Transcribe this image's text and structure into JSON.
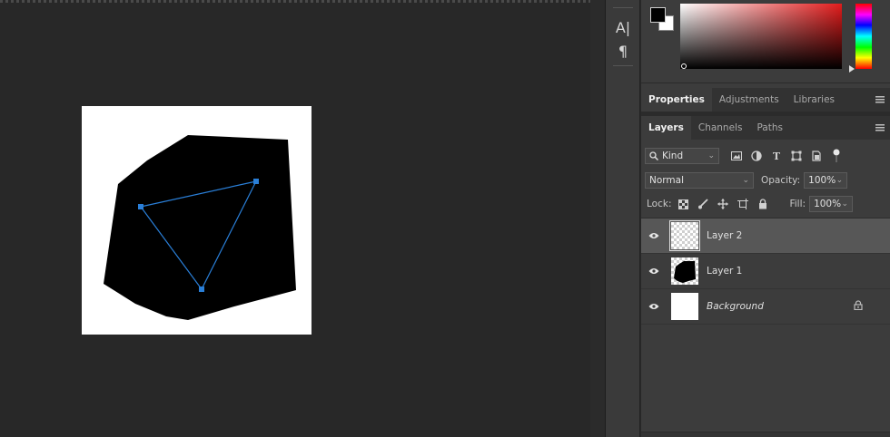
{
  "tools": {
    "text_tool_label": "A|",
    "paragraph_tool_label": "¶"
  },
  "colors": {
    "foreground": "#000000",
    "background": "#ffffff",
    "anchor_blue": "#2a7fd8",
    "selected_row": "#575757"
  },
  "properties_tabs": [
    {
      "label": "Properties",
      "active": true
    },
    {
      "label": "Adjustments",
      "active": false
    },
    {
      "label": "Libraries",
      "active": false
    }
  ],
  "layers_tabs": [
    {
      "label": "Layers",
      "active": true
    },
    {
      "label": "Channels",
      "active": false
    },
    {
      "label": "Paths",
      "active": false
    }
  ],
  "filter": {
    "kind_label": "Kind",
    "icons": [
      "image-filter-icon",
      "adjustment-filter-icon",
      "type-filter-icon",
      "shape-filter-icon",
      "smart-object-filter-icon"
    ]
  },
  "blend": {
    "mode": "Normal",
    "opacity_label": "Opacity:",
    "opacity_value": "100%"
  },
  "lock": {
    "label": "Lock:",
    "fill_label": "Fill:",
    "fill_value": "100%"
  },
  "layers": [
    {
      "name": "Layer 2",
      "selected": true,
      "visible": true,
      "thumbnail": "transparent",
      "italic": false,
      "locked": false
    },
    {
      "name": "Layer 1",
      "selected": false,
      "visible": true,
      "thumbnail": "black-shape",
      "italic": false,
      "locked": false
    },
    {
      "name": "Background",
      "selected": false,
      "visible": true,
      "thumbnail": "white",
      "italic": true,
      "locked": true
    }
  ]
}
